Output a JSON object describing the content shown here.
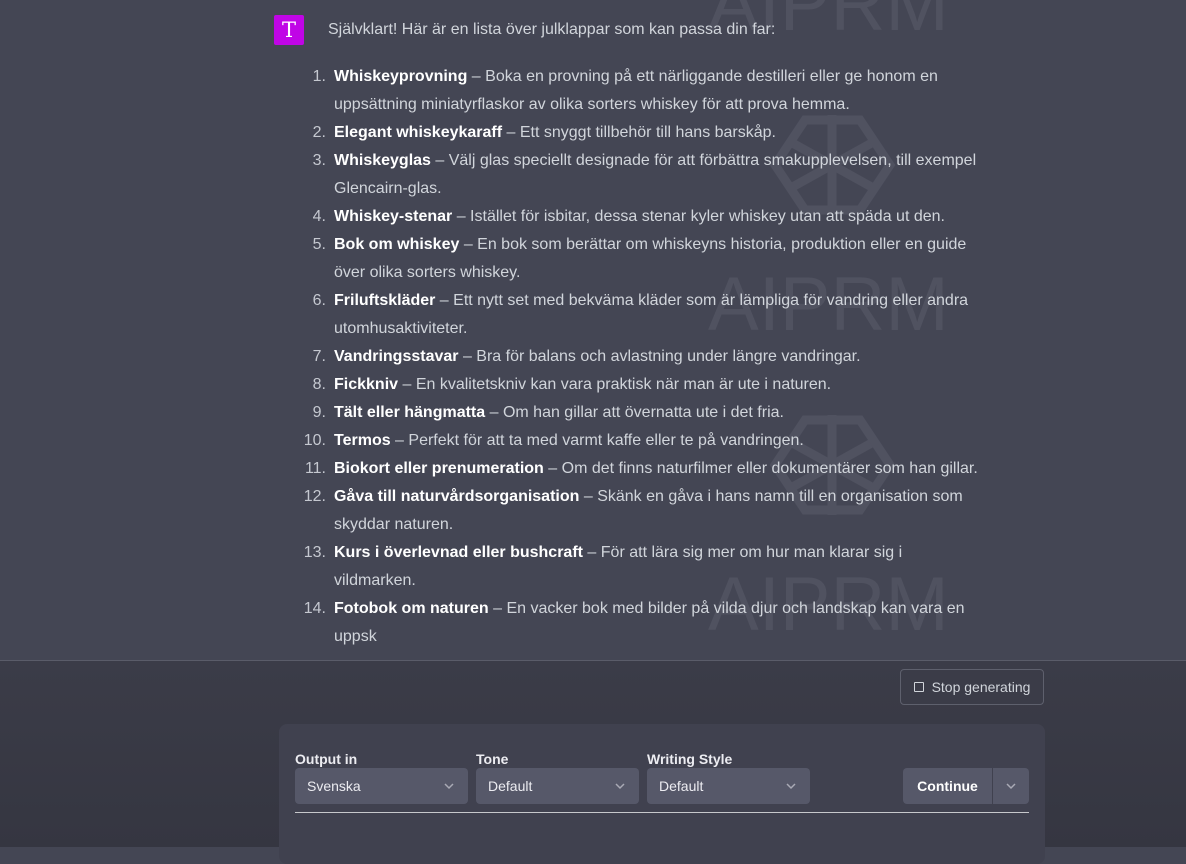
{
  "assistant": {
    "avatar_letter": "T",
    "intro": "Självklart! Här är en lista över julklappar som kan passa din far:"
  },
  "gift_list": [
    {
      "num": "1.",
      "title": "Whiskeyprovning",
      "desc": " – Boka en provning på ett närliggande destilleri eller ge honom en uppsättning miniatyrflaskor av olika sorters whiskey för att prova hemma."
    },
    {
      "num": "2.",
      "title": "Elegant whiskeykaraff",
      "desc": " – Ett snyggt tillbehör till hans barskåp."
    },
    {
      "num": "3.",
      "title": "Whiskeyglas",
      "desc": " – Välj glas speciellt designade för att förbättra smakupplevelsen, till exempel Glencairn-glas."
    },
    {
      "num": "4.",
      "title": "Whiskey-stenar",
      "desc": " – Istället för isbitar, dessa stenar kyler whiskey utan att späda ut den."
    },
    {
      "num": "5.",
      "title": "Bok om whiskey",
      "desc": " – En bok som berättar om whiskeyns historia, produktion eller en guide över olika sorters whiskey."
    },
    {
      "num": "6.",
      "title": "Friluftskläder",
      "desc": " – Ett nytt set med bekväma kläder som är lämpliga för vandring eller andra utomhusaktiviteter."
    },
    {
      "num": "7.",
      "title": "Vandringsstavar",
      "desc": " – Bra för balans och avlastning under längre vandringar."
    },
    {
      "num": "8.",
      "title": "Fickkniv",
      "desc": " – En kvalitetskniv kan vara praktisk när man är ute i naturen."
    },
    {
      "num": "9.",
      "title": "Tält eller hängmatta",
      "desc": " – Om han gillar att övernatta ute i det fria."
    },
    {
      "num": "10.",
      "title": "Termos",
      "desc": " – Perfekt för att ta med varmt kaffe eller te på vandringen."
    },
    {
      "num": "11.",
      "title": "Biokort eller prenumeration",
      "desc": " – Om det finns naturfilmer eller dokumentärer som han gillar."
    },
    {
      "num": "12.",
      "title": "Gåva till naturvårdsorganisation",
      "desc": " – Skänk en gåva i hans namn till en organisation som skyddar naturen."
    },
    {
      "num": "13.",
      "title": "Kurs i överlevnad eller bushcraft",
      "desc": " – För att lära sig mer om hur man klarar sig i vildmarken."
    },
    {
      "num": "14.",
      "title": "Fotobok om naturen",
      "desc": " – En vacker bok med bilder på vilda djur och landskap kan vara en uppsk"
    }
  ],
  "watermark_text": "AIPRM",
  "stop_button": {
    "label": "Stop generating",
    "icon": "stop-square-icon"
  },
  "controls": {
    "output": {
      "label": "Output in",
      "value": "Svenska"
    },
    "tone": {
      "label": "Tone",
      "value": "Default"
    },
    "style": {
      "label": "Writing Style",
      "value": "Default"
    },
    "continue_label": "Continue"
  },
  "colors": {
    "background": "#444654",
    "avatar": "#c005e6",
    "panel": "#40414f",
    "select": "#565869"
  }
}
